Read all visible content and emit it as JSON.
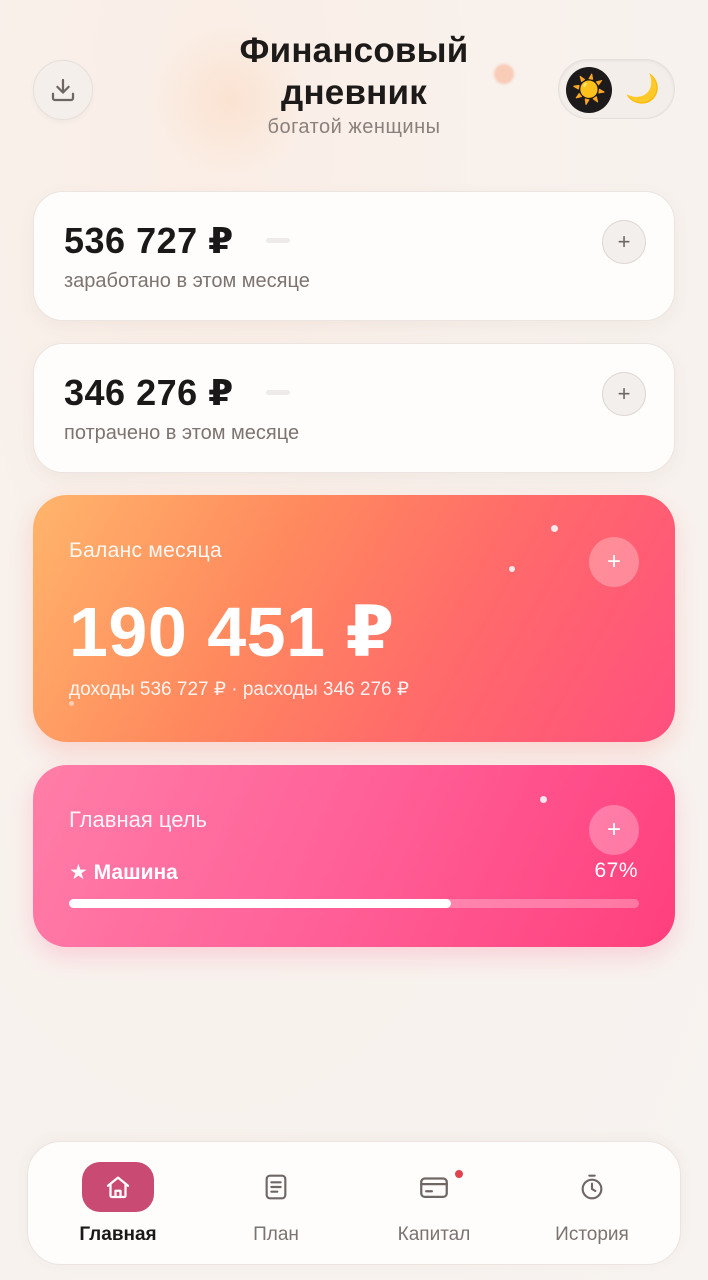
{
  "header": {
    "title_line1": "Финансовый",
    "title_line2": "дневник",
    "subtitle": "богатой женщины",
    "download_icon": "download-icon",
    "theme": {
      "sun_glyph": "☀️",
      "moon_glyph": "🌙",
      "active": "light"
    }
  },
  "income_card": {
    "amount": "536 727 ₽",
    "label": "заработано в этом месяце",
    "add_glyph": "+"
  },
  "expense_card": {
    "amount": "346 276 ₽",
    "label": "потрачено в этом месяце",
    "add_glyph": "+"
  },
  "balance_card": {
    "label": "Баланс месяца",
    "amount": "190 451 ₽",
    "summary": "доходы 536 727 ₽ · расходы 346 276 ₽",
    "add_glyph": "+"
  },
  "goal_card": {
    "label": "Главная цель",
    "goal_name": "★ Машина",
    "percent_text": "67%",
    "progress_fraction": 0.67,
    "add_glyph": "+"
  },
  "nav": {
    "items": [
      {
        "label": "Главная",
        "icon": "home-icon",
        "active": true
      },
      {
        "label": "План",
        "icon": "document-icon",
        "active": false
      },
      {
        "label": "Капитал",
        "icon": "card-icon",
        "active": false,
        "badge": true
      },
      {
        "label": "История",
        "icon": "stopwatch-icon",
        "active": false
      }
    ]
  },
  "colors": {
    "balance_gradient": [
      "#ffb56b",
      "#ff4f7f"
    ],
    "goal_gradient": [
      "#ff7ea8",
      "#ff3f7d"
    ],
    "nav_active": "#c94a73",
    "badge": "#e0424e"
  }
}
